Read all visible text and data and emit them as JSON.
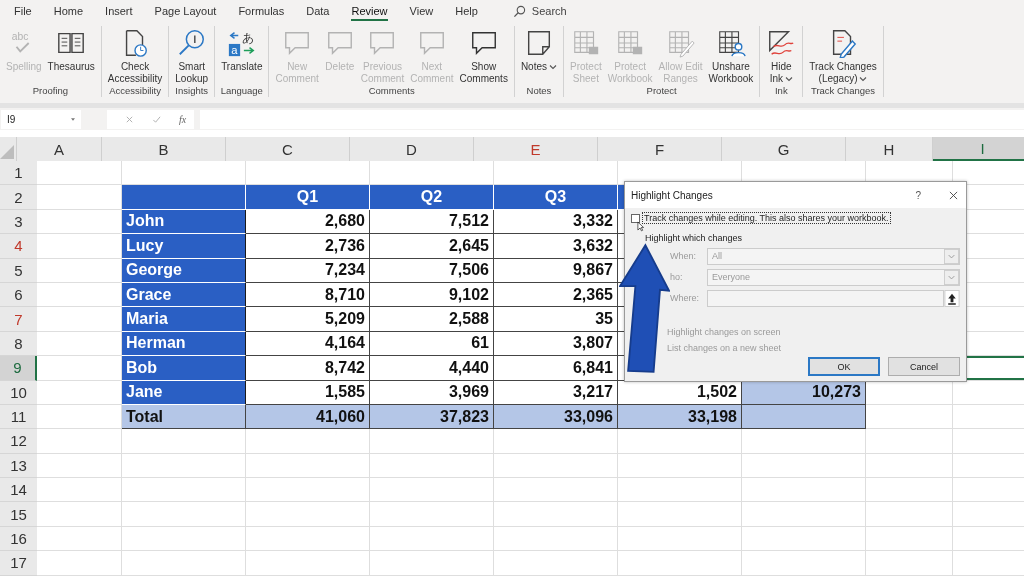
{
  "menu_tabs": [
    {
      "label": "File",
      "selected": false
    },
    {
      "label": "Home",
      "selected": false
    },
    {
      "label": "Insert",
      "selected": false
    },
    {
      "label": "Page Layout",
      "selected": false
    },
    {
      "label": "Formulas",
      "selected": false
    },
    {
      "label": "Data",
      "selected": false
    },
    {
      "label": "Review",
      "selected": true
    },
    {
      "label": "View",
      "selected": false
    },
    {
      "label": "Help",
      "selected": false
    }
  ],
  "search": {
    "placeholder": "Search"
  },
  "ribbon_groups": [
    {
      "label": "Proofing",
      "buttons": [
        {
          "label": "Spelling",
          "disabled": true,
          "icon_text": [
            "abc"
          ]
        },
        {
          "label": "Thesaurus",
          "disabled": false
        }
      ]
    },
    {
      "label": "Accessibility",
      "buttons": [
        {
          "label": "Check\nAccessibility",
          "disabled": false
        }
      ]
    },
    {
      "label": "Insights",
      "buttons": [
        {
          "label": "Smart\nLookup",
          "disabled": false
        }
      ]
    },
    {
      "label": "Language",
      "buttons": [
        {
          "label": "Translate",
          "disabled": false,
          "icon_text": [
            "a",
            "あ"
          ]
        }
      ]
    },
    {
      "label": "Comments",
      "buttons": [
        {
          "label": "New\nComment",
          "disabled": true
        },
        {
          "label": "Delete",
          "disabled": true
        },
        {
          "label": "Previous\nComment",
          "disabled": true
        },
        {
          "label": "Next\nComment",
          "disabled": true
        },
        {
          "label": "Show\nComments",
          "disabled": false
        }
      ]
    },
    {
      "label": "Notes",
      "buttons": [
        {
          "label": "Notes",
          "disabled": false,
          "dropdown": true
        }
      ]
    },
    {
      "label": "Protect",
      "buttons": [
        {
          "label": "Protect\nSheet",
          "disabled": true
        },
        {
          "label": "Protect\nWorkbook",
          "disabled": true
        },
        {
          "label": "Allow Edit\nRanges",
          "disabled": true
        },
        {
          "label": "Unshare\nWorkbook",
          "disabled": false
        }
      ]
    },
    {
      "label": "Ink",
      "buttons": [
        {
          "label": "Hide\nInk",
          "disabled": false,
          "dropdown": true
        }
      ]
    },
    {
      "label": "Track Changes",
      "buttons": [
        {
          "label": "Track Changes\n(Legacy)",
          "disabled": false,
          "dropdown": true
        }
      ]
    }
  ],
  "formula_bar": {
    "name_box": "I9",
    "function_label": "fx"
  },
  "columns": [
    {
      "label": "A",
      "selected": false,
      "flagged": false
    },
    {
      "label": "B",
      "selected": false,
      "flagged": false
    },
    {
      "label": "C",
      "selected": false,
      "flagged": false
    },
    {
      "label": "D",
      "selected": false,
      "flagged": false
    },
    {
      "label": "E",
      "selected": false,
      "flagged": true
    },
    {
      "label": "F",
      "selected": false,
      "flagged": false
    },
    {
      "label": "G",
      "selected": false,
      "flagged": false
    },
    {
      "label": "H",
      "selected": false,
      "flagged": false
    },
    {
      "label": "I",
      "selected": true,
      "flagged": false
    }
  ],
  "rows": [
    {
      "label": "1",
      "selected": false,
      "flagged": false
    },
    {
      "label": "2",
      "selected": false,
      "flagged": false
    },
    {
      "label": "3",
      "selected": false,
      "flagged": false
    },
    {
      "label": "4",
      "selected": false,
      "flagged": true
    },
    {
      "label": "5",
      "selected": false,
      "flagged": false
    },
    {
      "label": "6",
      "selected": false,
      "flagged": false
    },
    {
      "label": "7",
      "selected": false,
      "flagged": true
    },
    {
      "label": "8",
      "selected": false,
      "flagged": false
    },
    {
      "label": "9",
      "selected": true,
      "flagged": false
    },
    {
      "label": "10",
      "selected": false,
      "flagged": false
    },
    {
      "label": "11",
      "selected": false,
      "flagged": false
    },
    {
      "label": "12",
      "selected": false,
      "flagged": false
    },
    {
      "label": "13",
      "selected": false,
      "flagged": false
    },
    {
      "label": "14",
      "selected": false,
      "flagged": false
    },
    {
      "label": "15",
      "selected": false,
      "flagged": false
    },
    {
      "label": "16",
      "selected": false,
      "flagged": false
    },
    {
      "label": "17",
      "selected": false,
      "flagged": false
    }
  ],
  "table": {
    "columns": [
      "Q1",
      "Q2",
      "Q3"
    ],
    "rows": [
      {
        "name": "John",
        "values": [
          "2,680",
          "7,512",
          "3,332"
        ]
      },
      {
        "name": "Lucy",
        "values": [
          "2,736",
          "2,645",
          "3,632"
        ]
      },
      {
        "name": "George",
        "values": [
          "7,234",
          "7,506",
          "9,867"
        ]
      },
      {
        "name": "Grace",
        "values": [
          "8,710",
          "9,102",
          "2,365"
        ]
      },
      {
        "name": "Maria",
        "values": [
          "5,209",
          "2,588",
          "35"
        ]
      },
      {
        "name": "Herman",
        "values": [
          "4,164",
          "61",
          "3,807"
        ]
      },
      {
        "name": "Bob",
        "values": [
          "8,742",
          "4,440",
          "6,841"
        ]
      },
      {
        "name": "Jane",
        "values": [
          "1,585",
          "3,969",
          "3,217",
          "1,502",
          "10,273"
        ]
      }
    ],
    "total": {
      "name": "Total",
      "values": [
        "41,060",
        "37,823",
        "33,096",
        "33,198"
      ]
    }
  },
  "dialog": {
    "title": "Highlight Changes",
    "help": "?",
    "track_changes": {
      "label": "Track changes while editing. This also shares your workbook.",
      "checked": false
    },
    "section": "Highlight which changes",
    "fields": [
      {
        "kind": "select",
        "label": "When:",
        "value": "All",
        "disabled": true
      },
      {
        "kind": "select",
        "label": "ho:",
        "value": "Everyone",
        "disabled": true
      },
      {
        "kind": "range",
        "label": "Where:",
        "disabled": true
      }
    ],
    "options": [
      {
        "label": "Highlight changes on screen",
        "disabled": true
      },
      {
        "label": "List changes on a new sheet",
        "disabled": true
      }
    ],
    "buttons": [
      {
        "label": "OK",
        "default": true
      },
      {
        "label": "Cancel",
        "default": false
      }
    ]
  }
}
